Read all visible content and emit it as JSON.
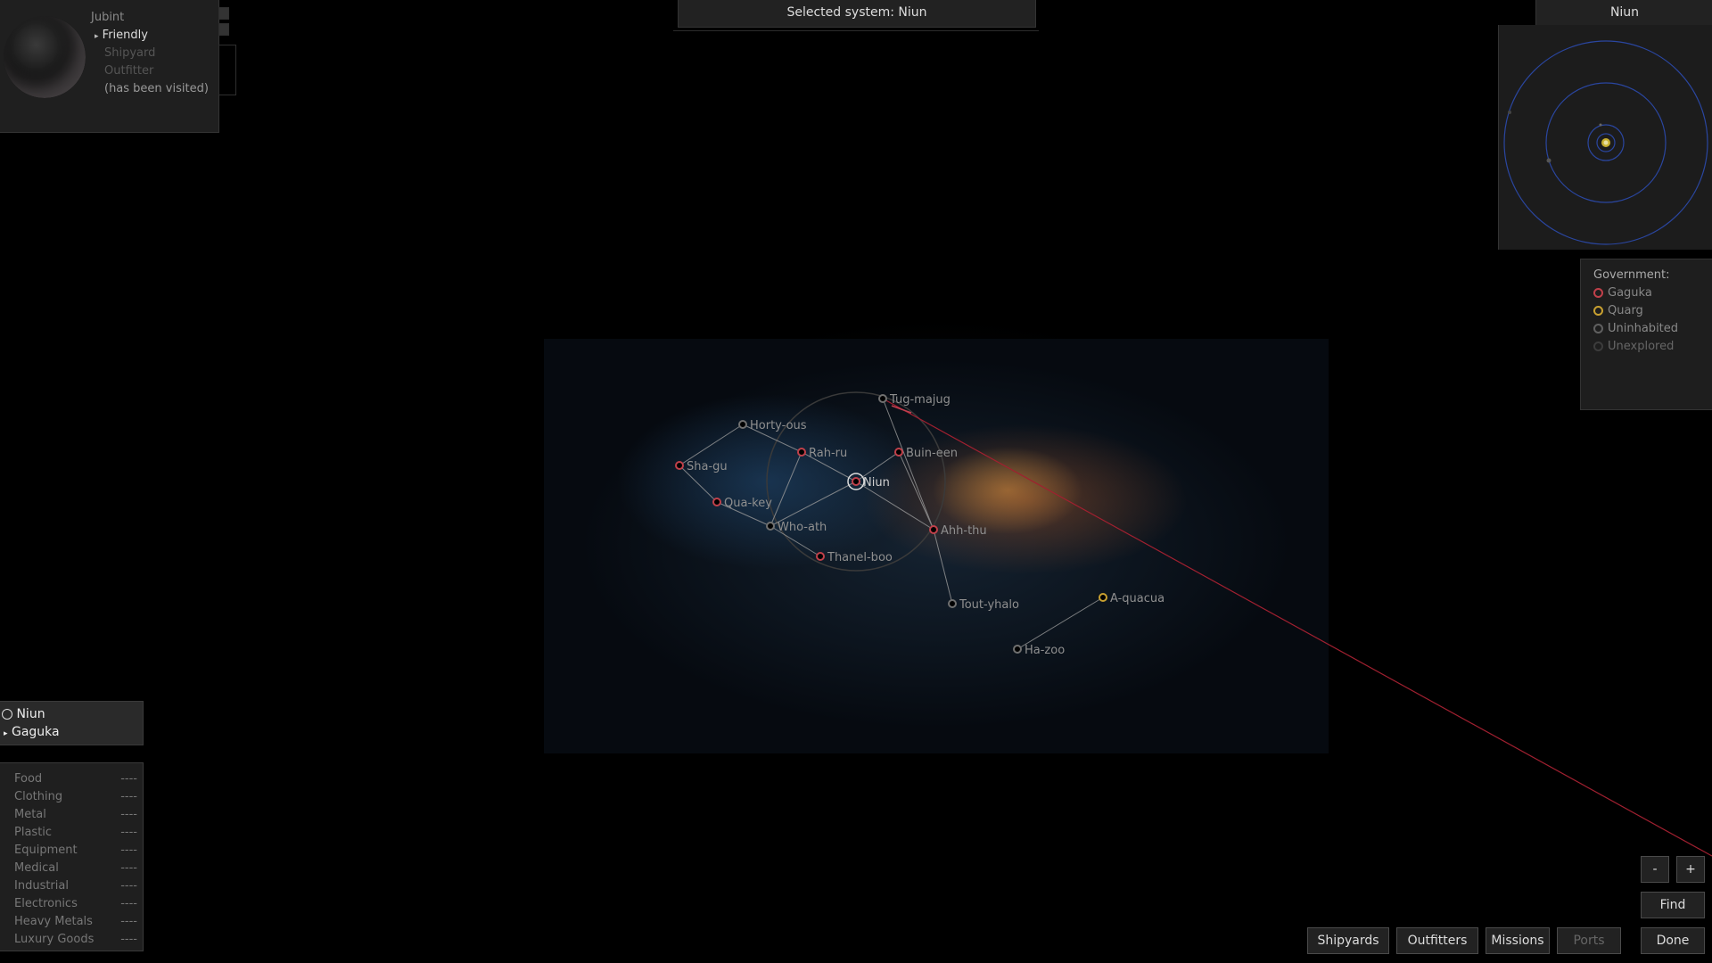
{
  "header": {
    "selected_system": "Selected system: Niun"
  },
  "planet_panel": {
    "planet_name": "Jubint",
    "attitude": "Friendly",
    "shipyard": "Shipyard",
    "outfitter": "Outfitter",
    "visited": "(has been visited)"
  },
  "orbit_panel": {
    "system_name": "Niun"
  },
  "government_legend": {
    "title": "Government:",
    "items": [
      {
        "label": "Gaguka",
        "color": "#c0404a"
      },
      {
        "label": "Quarg",
        "color": "#c8a030"
      },
      {
        "label": "Uninhabited",
        "color": "#606060"
      },
      {
        "label": "Unexplored",
        "color": "#3c3c3c"
      }
    ]
  },
  "system_info": {
    "name": "Niun",
    "government": "Gaguka"
  },
  "trade": {
    "items": [
      {
        "name": "Food",
        "value": "----"
      },
      {
        "name": "Clothing",
        "value": "----"
      },
      {
        "name": "Metal",
        "value": "----"
      },
      {
        "name": "Plastic",
        "value": "----"
      },
      {
        "name": "Equipment",
        "value": "----"
      },
      {
        "name": "Medical",
        "value": "----"
      },
      {
        "name": "Industrial",
        "value": "----"
      },
      {
        "name": "Electronics",
        "value": "----"
      },
      {
        "name": "Heavy Metals",
        "value": "----"
      },
      {
        "name": "Luxury Goods",
        "value": "----"
      }
    ]
  },
  "map": {
    "selected": "Niun",
    "systems": [
      {
        "name": "Tug-majug",
        "gov": "uninhabited"
      },
      {
        "name": "Horty-ous",
        "gov": "uninhabited"
      },
      {
        "name": "Rah-ru",
        "gov": "gaguka"
      },
      {
        "name": "Buin-een",
        "gov": "gaguka"
      },
      {
        "name": "Sha-gu",
        "gov": "gaguka"
      },
      {
        "name": "Niun",
        "gov": "gaguka"
      },
      {
        "name": "Qua-key",
        "gov": "gaguka"
      },
      {
        "name": "Who-ath",
        "gov": "uninhabited"
      },
      {
        "name": "Ahh-thu",
        "gov": "gaguka"
      },
      {
        "name": "Thanel-boo",
        "gov": "gaguka"
      },
      {
        "name": "Tout-yhalo",
        "gov": "uninhabited"
      },
      {
        "name": "A-quacua",
        "gov": "quarg"
      },
      {
        "name": "Ha-zoo",
        "gov": "uninhabited"
      }
    ]
  },
  "buttons": {
    "zoom_out": "-",
    "zoom_in": "+",
    "find": "Find",
    "shipyards": "Shipyards",
    "outfitters": "Outfitters",
    "missions": "Missions",
    "ports": "Ports",
    "done": "Done"
  },
  "colors": {
    "gaguka": "#c0404a",
    "quarg": "#c8a030",
    "uninhabited": "#707070",
    "route": "#a02030",
    "orbit": "#2a46a0"
  }
}
